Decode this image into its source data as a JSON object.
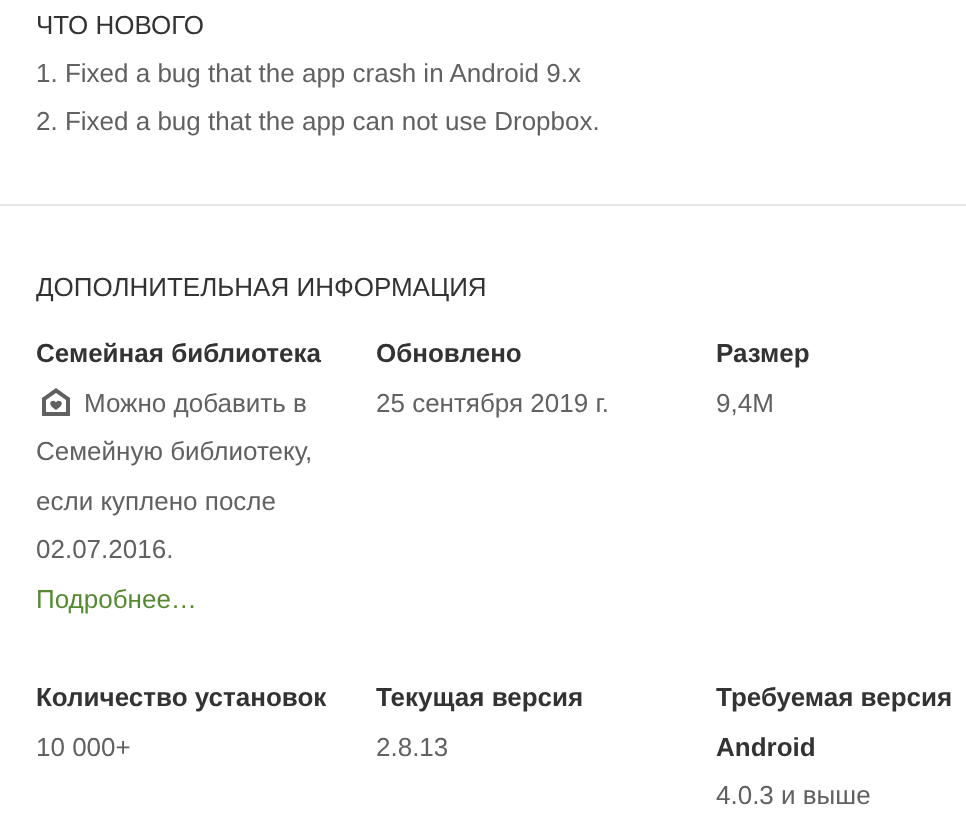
{
  "whats_new": {
    "heading": "ЧТО НОВОГО",
    "lines": [
      "1. Fixed a bug that the app crash in Android 9.x",
      "2. Fixed a bug that the app can not use Dropbox."
    ]
  },
  "additional_info": {
    "heading": "ДОПОЛНИТЕЛЬНАЯ ИНФОРМАЦИЯ",
    "items": [
      {
        "kind": "family",
        "label": "Семейная библиотека",
        "value": "Можно добавить в",
        "value_more": "Семейную библиотеку, если куплено после 02.07.2016.",
        "link": "Подробнее…"
      },
      {
        "kind": "text",
        "label": "Обновлено",
        "value": "25 сентября 2019 г."
      },
      {
        "kind": "text",
        "label": "Размер",
        "value": "9,4M"
      },
      {
        "kind": "text",
        "label": "Количество установок",
        "value": "10 000+"
      },
      {
        "kind": "text",
        "label": "Текущая версия",
        "value": "2.8.13"
      },
      {
        "kind": "text",
        "label": "Требуемая версия Android",
        "value": "4.0.3 и выше"
      }
    ]
  }
}
